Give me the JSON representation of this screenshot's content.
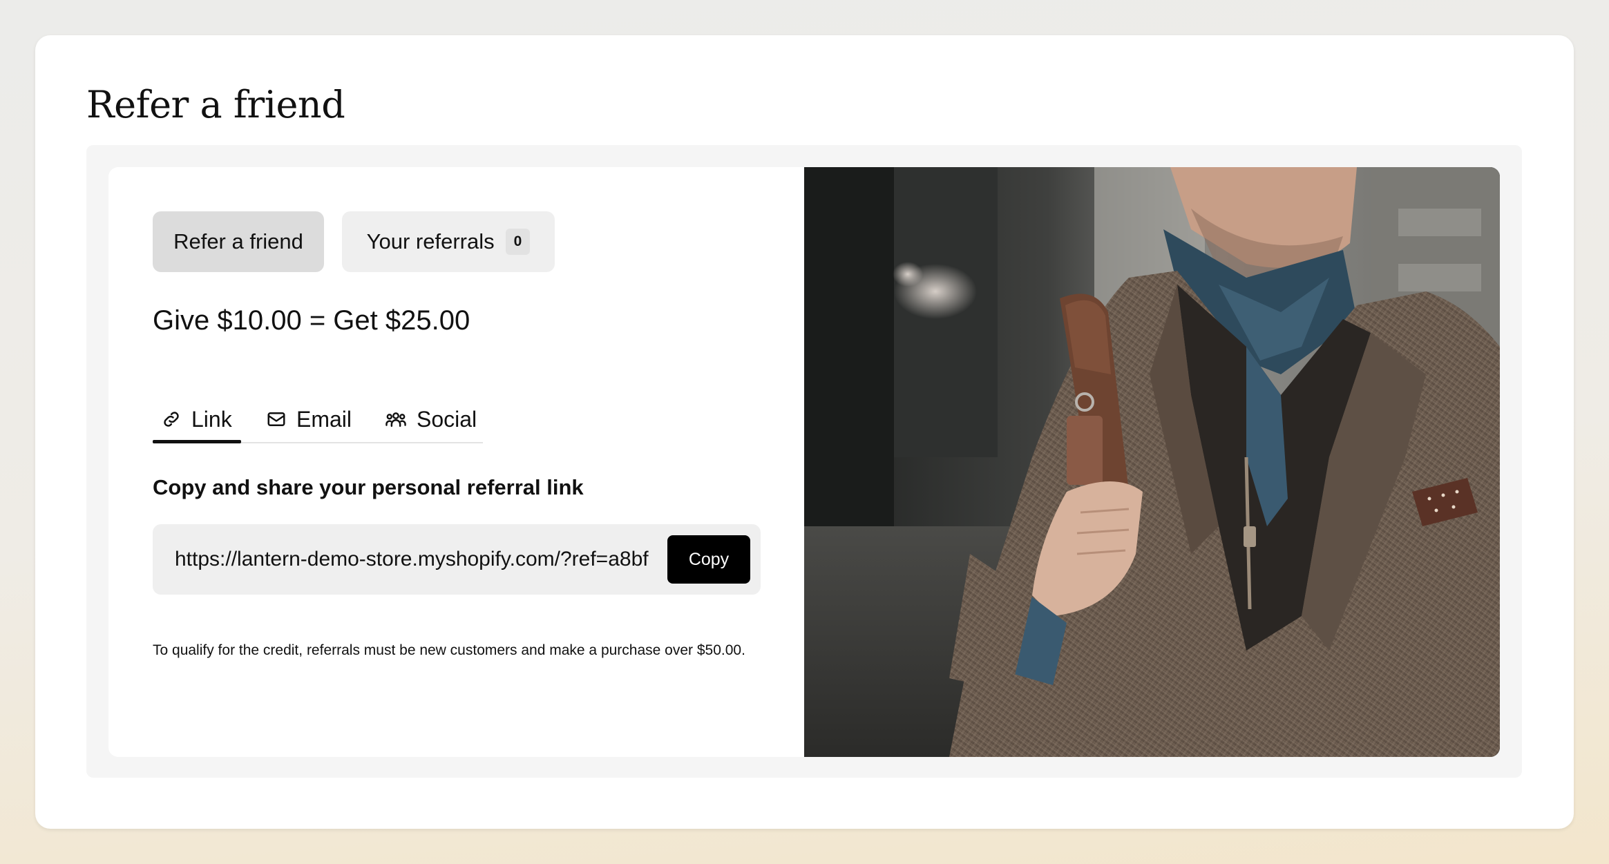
{
  "page": {
    "title": "Refer a friend"
  },
  "widget": {
    "toggle": {
      "refer_label": "Refer a friend",
      "referrals_label": "Your referrals",
      "referrals_count": "0"
    },
    "offer_text": "Give $10.00 = Get $25.00",
    "tabs": [
      {
        "label": "Link",
        "icon": "link-icon",
        "active": true
      },
      {
        "label": "Email",
        "icon": "mail-icon",
        "active": false
      },
      {
        "label": "Social",
        "icon": "people-icon",
        "active": false
      }
    ],
    "share_heading": "Copy and share your personal referral link",
    "referral_link": "https://lantern-demo-store.myshopify.com/?ref=a8bf",
    "copy_label": "Copy",
    "fineprint": "To qualify for the credit, referrals must be new customers and make a purchase over $50.00."
  },
  "image": {
    "subject": "man-in-tweed-jacket-photo"
  },
  "colors": {
    "active_pill": "#dcdcdc",
    "inactive_pill": "#efefef",
    "copy_button": "#000000",
    "accent_text": "#111111"
  }
}
